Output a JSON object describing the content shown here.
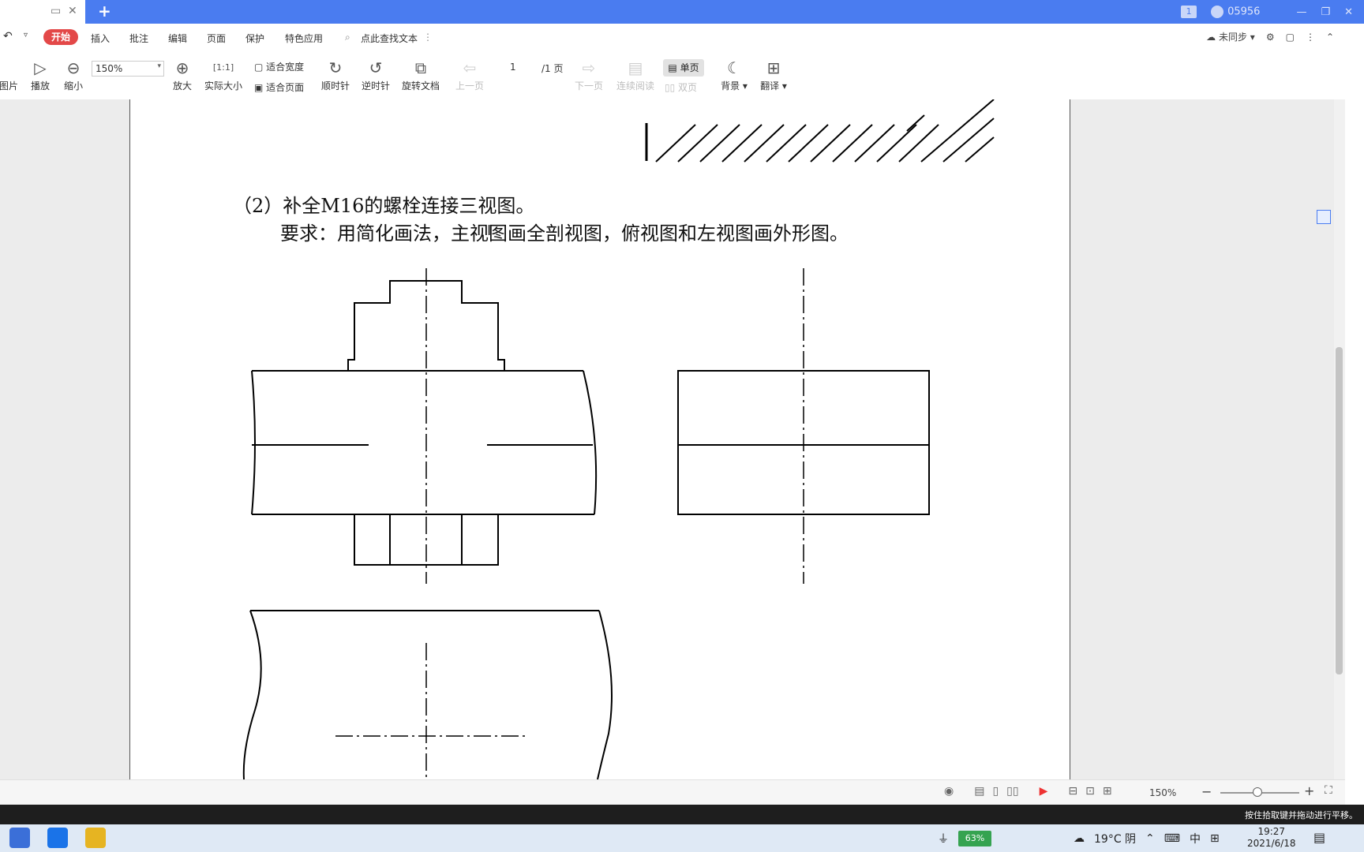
{
  "titlebar": {
    "account": "05956",
    "badge": "1",
    "new_tab_symbol": "+"
  },
  "menubar": {
    "start": "开始",
    "items": [
      "插入",
      "批注",
      "编辑",
      "页面",
      "保护",
      "特色应用"
    ],
    "search_text": "点此查找文本",
    "sync_status": "未同步"
  },
  "toolbar": {
    "picture": "图片",
    "play": "播放",
    "zoom_out": "缩小",
    "zoom_value": "150%",
    "zoom_in": "放大",
    "actual_size": "实际大小",
    "fit_width": "适合宽度",
    "fit_page": "适合页面",
    "clockwise": "顺时针",
    "counterclockwise": "逆时针",
    "rotate_doc": "旋转文档",
    "prev_page": "上一页",
    "page_current": "1",
    "page_total": "/1 页",
    "next_page": "下一页",
    "continuous": "连续阅读",
    "single_page": "单页",
    "double_page": "双页",
    "background": "背景",
    "translate": "翻译"
  },
  "document": {
    "heading": "（2）补全M16的螺栓连接三视图。",
    "requirement": "要求：用简化画法，主视图画全剖视图，俯视图和左视图画外形图。"
  },
  "statusbar": {
    "zoom": "150%"
  },
  "hint": "按住拾取键并拖动进行平移。",
  "taskbar": {
    "battery": "63%",
    "weather": "19°C  阴",
    "ime": "中",
    "time": "19:27",
    "date": "2021/6/18"
  }
}
